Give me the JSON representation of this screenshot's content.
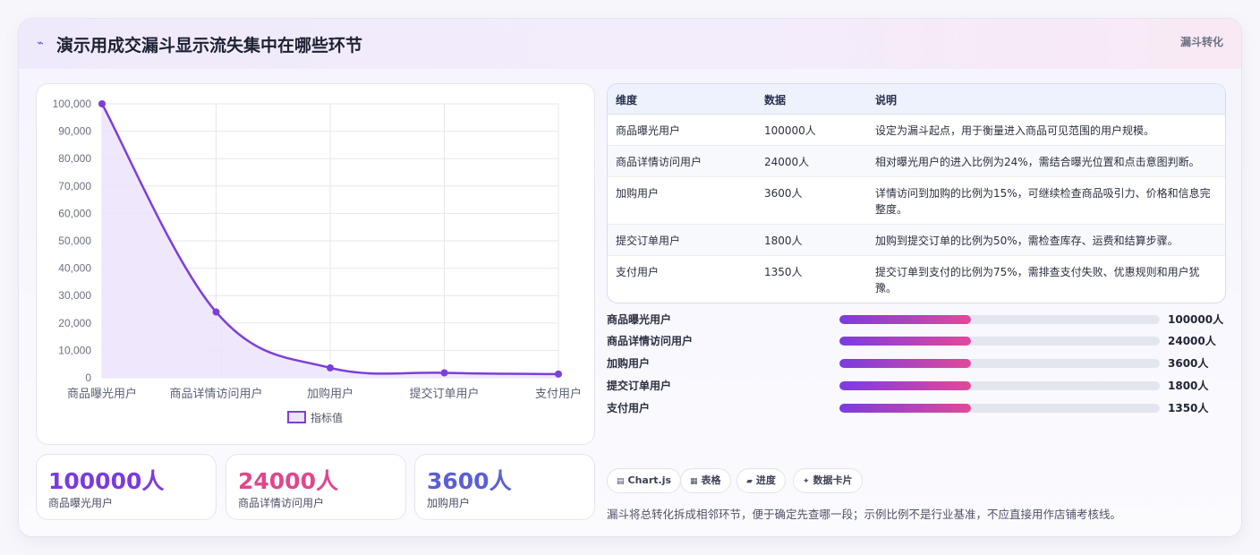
{
  "header": {
    "icon": "trend-line-icon",
    "title": "演示用成交漏斗显示流失集中在哪些环节",
    "tag": "漏斗转化"
  },
  "chart_data": {
    "type": "area",
    "categories": [
      "商品曝光用户",
      "商品详情访问用户",
      "加购用户",
      "提交订单用户",
      "支付用户"
    ],
    "series": [
      {
        "name": "指标值",
        "values": [
          100000,
          24000,
          3600,
          1800,
          1350
        ]
      }
    ],
    "ylim": [
      0,
      100000
    ],
    "yticks": [
      "0",
      "10,000",
      "20,000",
      "30,000",
      "40,000",
      "50,000",
      "60,000",
      "70,000",
      "80,000",
      "90,000",
      "100,000"
    ],
    "grid": true,
    "legend": "bottom",
    "colors": {
      "line": "#7b3fd9",
      "fill": "#ece3fa"
    }
  },
  "stats": [
    {
      "value": "100000人",
      "label": "商品曝光用户",
      "color": "#7b3ae0"
    },
    {
      "value": "24000人",
      "label": "商品详情访问用户",
      "color": "#e0468e"
    },
    {
      "value": "3600人",
      "label": "加购用户",
      "color": "#5a5fd8"
    }
  ],
  "table": {
    "headers": [
      "维度",
      "数据",
      "说明"
    ],
    "rows": [
      [
        "商品曝光用户",
        "100000人",
        "设定为漏斗起点，用于衡量进入商品可见范围的用户规模。"
      ],
      [
        "商品详情访问用户",
        "24000人",
        "相对曝光用户的进入比例为24%，需结合曝光位置和点击意图判断。"
      ],
      [
        "加购用户",
        "3600人",
        "详情访问到加购的比例为15%，可继续检查商品吸引力、价格和信息完整度。"
      ],
      [
        "提交订单用户",
        "1800人",
        "加购到提交订单的比例为50%，需检查库存、运费和结算步骤。"
      ],
      [
        "支付用户",
        "1350人",
        "提交订单到支付的比例为75%，需排查支付失败、优惠规则和用户犹豫。"
      ]
    ]
  },
  "progress": [
    {
      "label": "商品曝光用户",
      "value": "100000人",
      "fill": 0.41
    },
    {
      "label": "商品详情访问用户",
      "value": "24000人",
      "fill": 0.41
    },
    {
      "label": "加购用户",
      "value": "3600人",
      "fill": 0.41
    },
    {
      "label": "提交订单用户",
      "value": "1800人",
      "fill": 0.41
    },
    {
      "label": "支付用户",
      "value": "1350人",
      "fill": 0.41
    }
  ],
  "chips": [
    {
      "icon": "chart-icon",
      "glyph": "▤",
      "label": "Chart.js"
    },
    {
      "icon": "table-icon",
      "glyph": "▦",
      "label": "表格"
    },
    {
      "icon": "progress-icon",
      "glyph": "▰",
      "label": "进度"
    },
    {
      "icon": "sparkle-icon",
      "glyph": "✦",
      "label": "数据卡片"
    }
  ],
  "note": "漏斗将总转化拆成相邻环节，便于确定先查哪一段；示例比例不是行业基准，不应直接用作店铺考核线。"
}
